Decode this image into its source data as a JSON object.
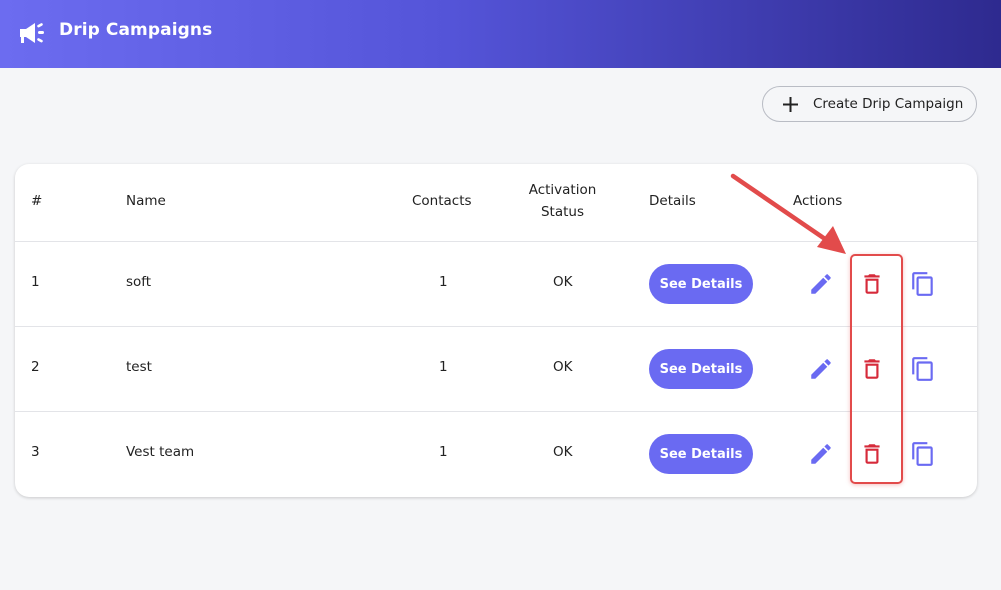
{
  "header": {
    "title": "Drip Campaigns",
    "icon": "megaphone-icon",
    "gradient": [
      "#6c6cf0",
      "#2e2a8f"
    ]
  },
  "toolbar": {
    "create_label": "Create Drip Campaign",
    "create_icon": "plus-icon"
  },
  "table": {
    "columns": [
      "#",
      "Name",
      "Contacts",
      "Activation Status",
      "Details",
      "Actions"
    ],
    "activation_line1": "Activation",
    "activation_line2": "Status",
    "rows": [
      {
        "num": "1",
        "name": "soft",
        "contacts": "1",
        "status": "OK",
        "details_label": "See Details"
      },
      {
        "num": "2",
        "name": "test",
        "contacts": "1",
        "status": "OK",
        "details_label": "See Details"
      },
      {
        "num": "3",
        "name": "Vest team",
        "contacts": "1",
        "status": "OK",
        "details_label": "See Details"
      }
    ]
  },
  "colors": {
    "accent": "#6a6af2",
    "delete": "#d62a3a",
    "annotation": "#e24b4b"
  },
  "annotation": {
    "type": "arrow-and-box",
    "target": "delete-buttons"
  }
}
